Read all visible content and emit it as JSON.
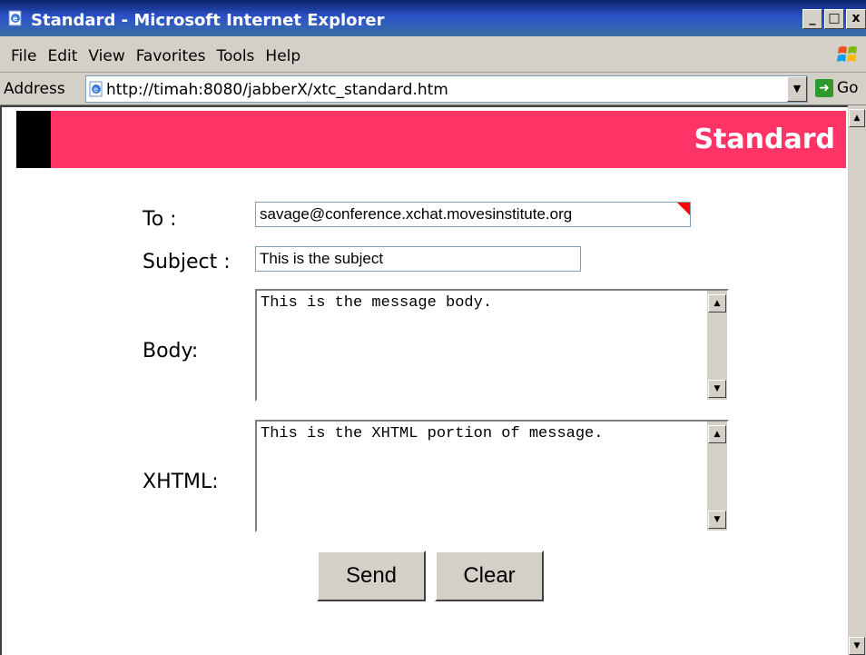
{
  "window": {
    "title": "Standard - Microsoft Internet Explorer",
    "minimize": "_",
    "maximize": "□",
    "close": "x"
  },
  "menu": [
    "File",
    "Edit",
    "View",
    "Favorites",
    "Tools",
    "Help"
  ],
  "address": {
    "label": "Address",
    "url": "http://timah:8080/jabberX/xtc_standard.htm",
    "go_label": "Go"
  },
  "banner": {
    "title": "Standard",
    "color": "#ff3366"
  },
  "form": {
    "to_label": "To :",
    "to_value": "savage@conference.xchat.movesinstitute.org",
    "subject_label": "Subject :",
    "subject_value": "This is the subject",
    "body_label": "Body:",
    "body_value": "This is the message body.",
    "xhtml_label": "XHTML:",
    "xhtml_value": "This is the XHTML portion of message."
  },
  "buttons": {
    "send": "Send",
    "clear": "Clear"
  },
  "icons": {
    "app": "ie-page-icon",
    "windows_logo": "windows-logo-icon",
    "go": "go-arrow-icon"
  }
}
